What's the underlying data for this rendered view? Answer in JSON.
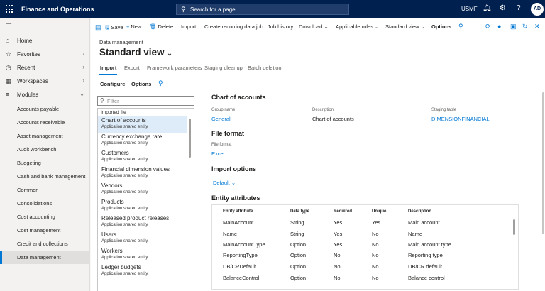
{
  "topbar": {
    "app_title": "Finance and Operations",
    "search_placeholder": "Search for a page",
    "company": "USMF",
    "avatar_initials": "AD"
  },
  "sidebar": {
    "nav": [
      {
        "label": "Home",
        "icon": "home-icon"
      },
      {
        "label": "Favorites",
        "icon": "star-icon"
      },
      {
        "label": "Recent",
        "icon": "clock-icon"
      },
      {
        "label": "Workspaces",
        "icon": "workspaces-icon"
      },
      {
        "label": "Modules",
        "icon": "list-icon"
      }
    ],
    "modules": [
      "Accounts payable",
      "Accounts receivable",
      "Asset management",
      "Audit workbench",
      "Budgeting",
      "Cash and bank management",
      "Common",
      "Consolidations",
      "Cost accounting",
      "Cost management",
      "Credit and collections",
      "Data management"
    ],
    "active_module": "Data management"
  },
  "actionbar": {
    "save": "Save",
    "new": "New",
    "delete": "Delete",
    "import": "Import",
    "create_recurring": "Create recurring data job",
    "job_history": "Job history",
    "download": "Download",
    "applicable_roles": "Applicable roles",
    "standard_view": "Standard view",
    "options": "Options"
  },
  "page": {
    "breadcrumb": "Data management",
    "title": "Standard view",
    "tabs": [
      "Import",
      "Export",
      "Framework parameters",
      "Staging cleanup",
      "Batch deletion"
    ],
    "subtabs": [
      "Configure",
      "Options"
    ],
    "filter_placeholder": "Filter"
  },
  "entity_list": {
    "header": "Imported file",
    "items": [
      {
        "name": "Chart of accounts",
        "type": "Application shared entity"
      },
      {
        "name": "Currency exchange rate",
        "type": "Application shared entity"
      },
      {
        "name": "Customers",
        "type": "Application shared entity"
      },
      {
        "name": "Financial dimension values",
        "type": "Application shared entity"
      },
      {
        "name": "Vendors",
        "type": "Application shared entity"
      },
      {
        "name": "Products",
        "type": "Application shared entity"
      },
      {
        "name": "Released product releases",
        "type": "Application shared entity"
      },
      {
        "name": "Users",
        "type": "Application shared entity"
      },
      {
        "name": "Workers",
        "type": "Application shared entity"
      },
      {
        "name": "Ledger budgets",
        "type": "Application shared entity"
      }
    ]
  },
  "details": {
    "title": "Chart of accounts",
    "group_name_label": "Group name",
    "group_name": "General",
    "description_label": "Description",
    "description": "Chart of accounts",
    "staging_table_label": "Staging table",
    "staging_table": "DIMENSIONFINANCIAL",
    "file_format_heading": "File format",
    "file_format_label": "File format",
    "file_format": "Excel",
    "import_options_heading": "Import options",
    "import_option": "Default",
    "entity_attributes_heading": "Entity attributes"
  },
  "attributes": {
    "columns": [
      "Entity attribute",
      "Data type",
      "Required",
      "Unique",
      "Description"
    ],
    "rows": [
      [
        "MainAccount",
        "String",
        "Yes",
        "Yes",
        "Main account"
      ],
      [
        "Name",
        "String",
        "Yes",
        "No",
        "Name"
      ],
      [
        "MainAccountType",
        "Option",
        "Yes",
        "No",
        "Main account type"
      ],
      [
        "ReportingType",
        "Option",
        "No",
        "No",
        "Reporting type"
      ],
      [
        "DB/CRDefault",
        "Option",
        "No",
        "No",
        "DB/CR default"
      ],
      [
        "BalanceControl",
        "Option",
        "No",
        "No",
        "Balance control"
      ]
    ]
  },
  "colors": {
    "topbar": "#002050",
    "accent": "#0078d4",
    "selected_row": "#deecf9"
  }
}
